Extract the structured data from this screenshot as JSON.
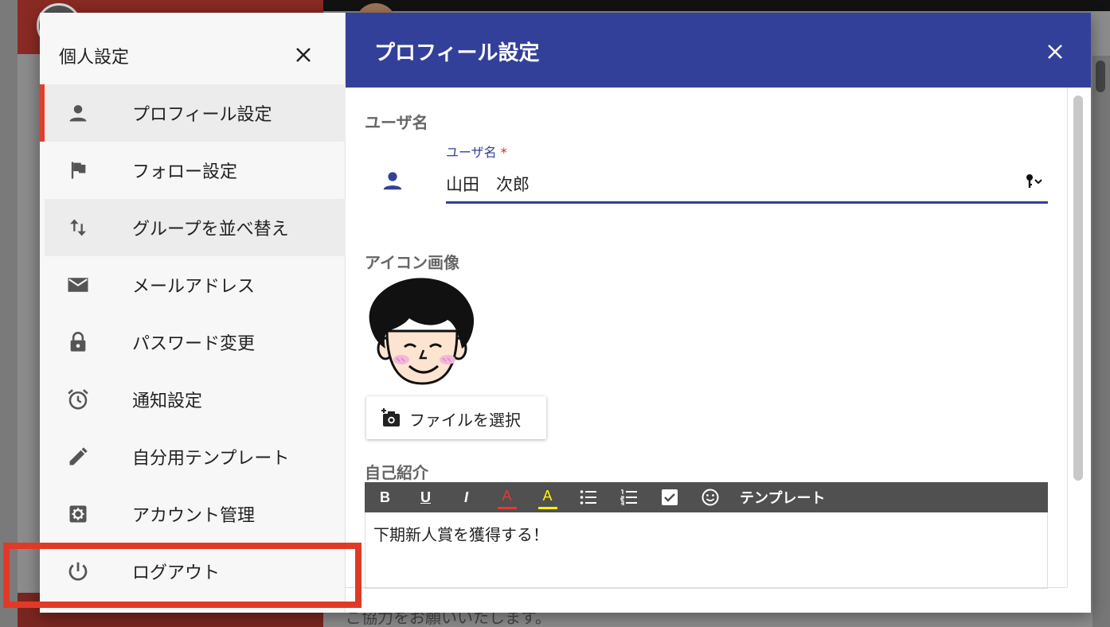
{
  "background": {
    "bottom_text": "ご協力をお願いいたします。"
  },
  "sidebar": {
    "title": "個人設定",
    "items": [
      {
        "label": "プロフィール設定",
        "icon": "person-icon",
        "state": "active"
      },
      {
        "label": "フォロー設定",
        "icon": "flag-icon",
        "state": "normal"
      },
      {
        "label": "グループを並べ替え",
        "icon": "swap-vert-icon",
        "state": "hover"
      },
      {
        "label": "メールアドレス",
        "icon": "mail-icon",
        "state": "normal"
      },
      {
        "label": "パスワード変更",
        "icon": "lock-icon",
        "state": "normal"
      },
      {
        "label": "通知設定",
        "icon": "alarm-icon",
        "state": "normal"
      },
      {
        "label": "自分用テンプレート",
        "icon": "pencil-icon",
        "state": "normal"
      },
      {
        "label": "アカウント管理",
        "icon": "settings-icon",
        "state": "normal"
      },
      {
        "label": "ログアウト",
        "icon": "power-icon",
        "state": "normal"
      }
    ]
  },
  "content": {
    "title": "プロフィール設定",
    "username_section": "ユーザ名",
    "username_field_label": "ユーザ名",
    "required_mark": "*",
    "username_value": "山田　次郎",
    "icon_section": "アイコン画像",
    "file_button_label": "ファイルを選択",
    "bio_section": "自己紹介",
    "toolbar": {
      "bold": "B",
      "underline": "U",
      "italic": "I",
      "font_color": "A",
      "highlight": "A",
      "template": "テンプレート"
    },
    "bio_text": "下期新人賞を獲得する！"
  },
  "colors": {
    "header_blue": "#33409a",
    "accent_red": "#e0402a",
    "highlight_box": "#e03a26",
    "font_color_bar": "#e53935",
    "highlight_bar": "#fff200"
  }
}
